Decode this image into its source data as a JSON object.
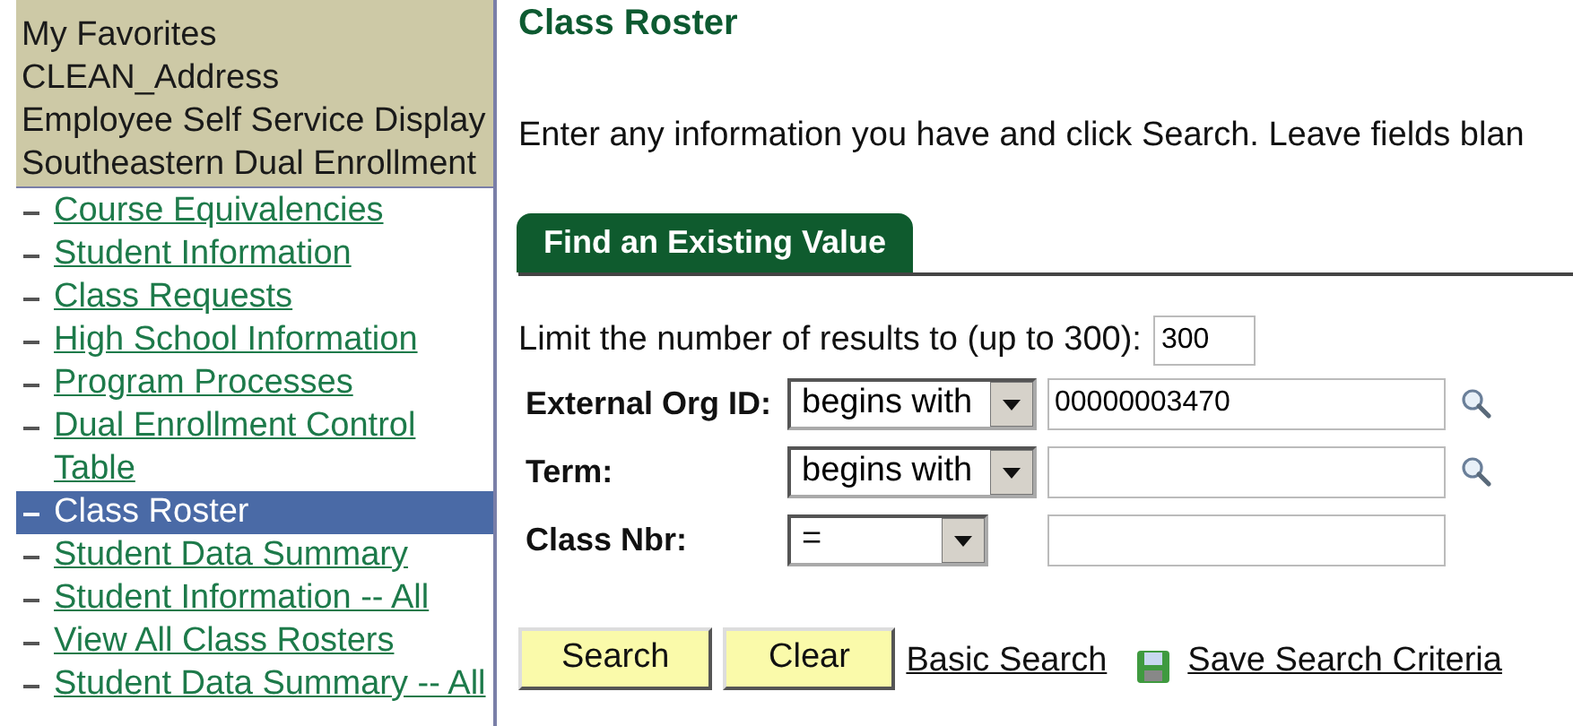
{
  "sidebar": {
    "headers": [
      "My Favorites",
      "CLEAN_Address",
      "Employee Self Service Display",
      "Southeastern Dual Enrollment"
    ],
    "items": [
      {
        "label": "Course Equivalencies",
        "selected": false
      },
      {
        "label": "Student Information",
        "selected": false
      },
      {
        "label": "Class Requests",
        "selected": false
      },
      {
        "label": "High School Information",
        "selected": false
      },
      {
        "label": "Program Processes",
        "selected": false
      },
      {
        "label": "Dual Enrollment Control Table",
        "selected": false
      },
      {
        "label": "Class Roster",
        "selected": true
      },
      {
        "label": "Student Data Summary",
        "selected": false
      },
      {
        "label": "Student Information -- All",
        "selected": false
      },
      {
        "label": "View All Class Rosters",
        "selected": false
      },
      {
        "label": "Student Data Summary -- All",
        "selected": false
      }
    ]
  },
  "page": {
    "title": "Class Roster",
    "instruction": "Enter any information you have and click Search. Leave fields blan",
    "tabs": [
      {
        "label": "Find an Existing Value",
        "selected": true
      }
    ],
    "limit": {
      "label": "Limit the number of results to (up to 300):",
      "value": "300"
    },
    "fields": [
      {
        "label": "External Org ID:",
        "operator": "begins with",
        "value": "00000003470",
        "lookup": true
      },
      {
        "label": "Term:",
        "operator": "begins with",
        "lookup": true
      },
      {
        "label": "Class Nbr:",
        "operator": "=",
        "lookup": false
      }
    ],
    "buttons": [
      "Search",
      "Clear"
    ],
    "links": [
      "Basic Search",
      "Save Search Criteria"
    ]
  }
}
